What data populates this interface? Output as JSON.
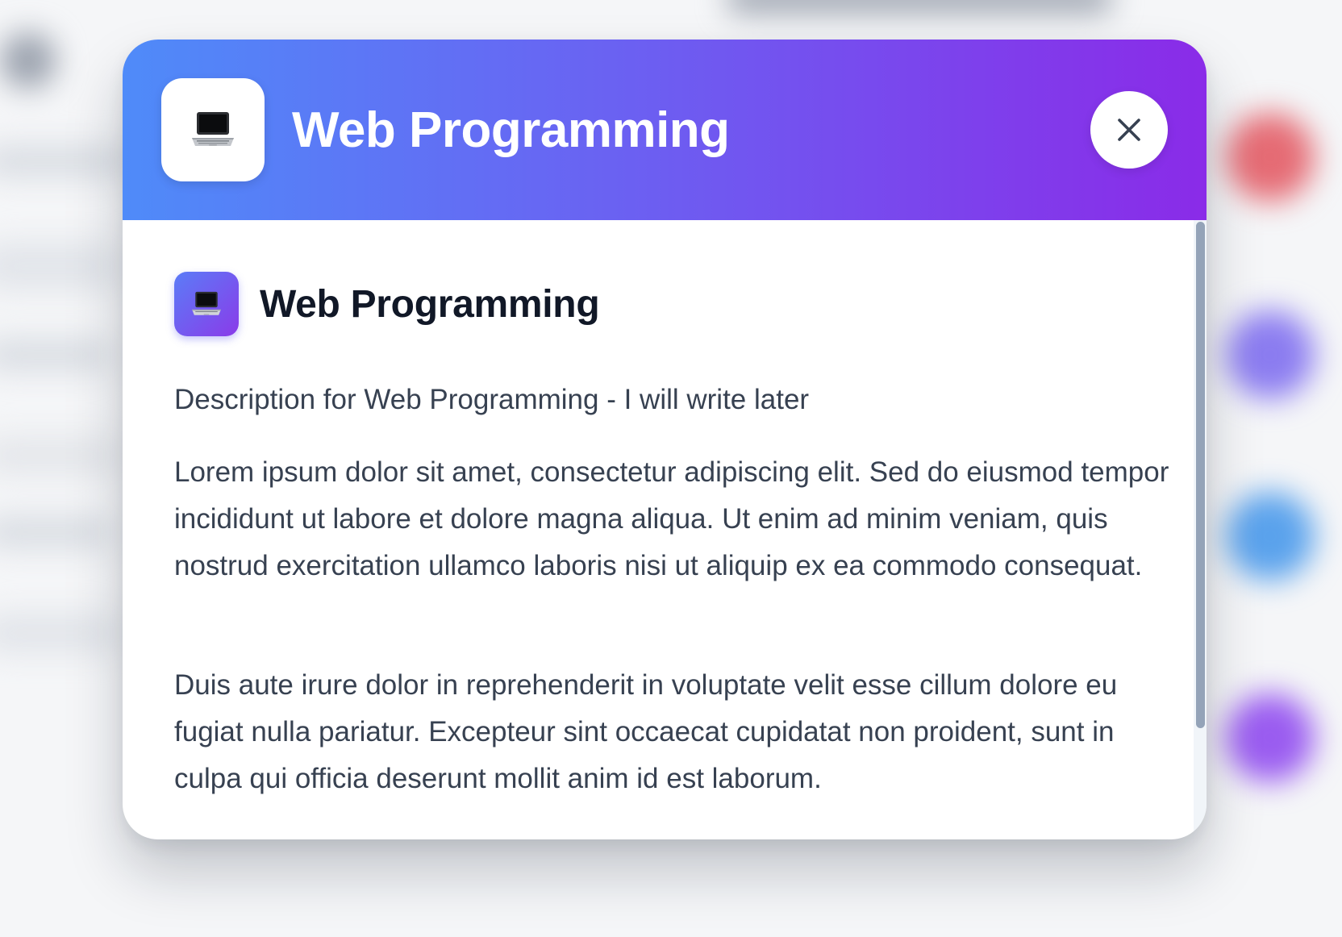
{
  "modal": {
    "header": {
      "title": "Web Programming",
      "icon": "laptop-icon",
      "close_icon": "close-icon",
      "gradient": [
        "#4f8bf9",
        "#8a2be8"
      ]
    },
    "content": {
      "title": "Web Programming",
      "icon": "laptop-icon",
      "description": "Description for Web Programming - I will write later",
      "paragraphs": [
        "Lorem ipsum dolor sit amet, consectetur adipiscing elit. Sed do eiusmod tempor incididunt ut labore et dolore magna aliqua. Ut enim ad minim veniam, quis nostrud exercitation ullamco laboris nisi ut aliquip ex ea commodo consequat.",
        "Duis aute irure dolor in reprehenderit in voluptate velit esse cillum dolore eu fugiat nulla pariatur. Excepteur sint occaecat cupidatat non proident, sunt in culpa qui officia deserunt mollit anim id est laborum."
      ]
    }
  },
  "colors": {
    "title_text": "#111827",
    "body_text": "#374151",
    "scrollbar_thumb": "#94a3b8"
  }
}
